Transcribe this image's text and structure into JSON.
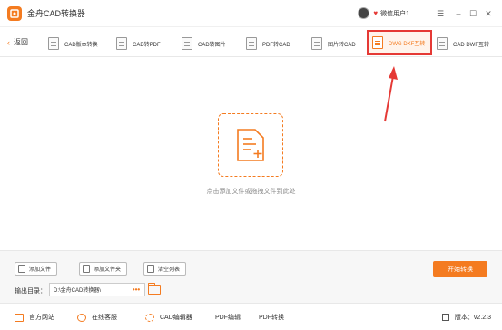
{
  "app": {
    "title": "金舟CAD转换器"
  },
  "user": {
    "name": "微信用户1"
  },
  "window_controls": {
    "menu": "☰",
    "minimize": "–",
    "maximize": "☐",
    "close": "✕"
  },
  "toolbar": {
    "back_label": "返回",
    "tools": [
      {
        "label": "CAD版本转换"
      },
      {
        "label": "CAD转PDF"
      },
      {
        "label": "CAD转图片"
      },
      {
        "label": "PDF转CAD"
      },
      {
        "label": "图片转CAD"
      },
      {
        "label": "DWG DXF互转"
      },
      {
        "label": "CAD DWF互转"
      }
    ]
  },
  "main": {
    "drop_hint": "点击添加文件或拖拽文件到此处"
  },
  "bottom": {
    "add_file": "添加文件",
    "add_folder": "添加文件夹",
    "clear_list": "清空列表",
    "start_button": "开始转换",
    "output_label": "输出目录：",
    "output_path": "D:\\金舟CAD转换器\\",
    "browse": "•••"
  },
  "status": {
    "items": [
      {
        "label": "官方网站"
      },
      {
        "label": "在线客服"
      },
      {
        "label": "CAD编辑器"
      },
      {
        "label": "PDF编辑"
      },
      {
        "label": "PDF转换"
      }
    ],
    "version": "版本：v2.2.3"
  },
  "colors": {
    "accent": "#f47b20",
    "highlight": "#e53935"
  }
}
